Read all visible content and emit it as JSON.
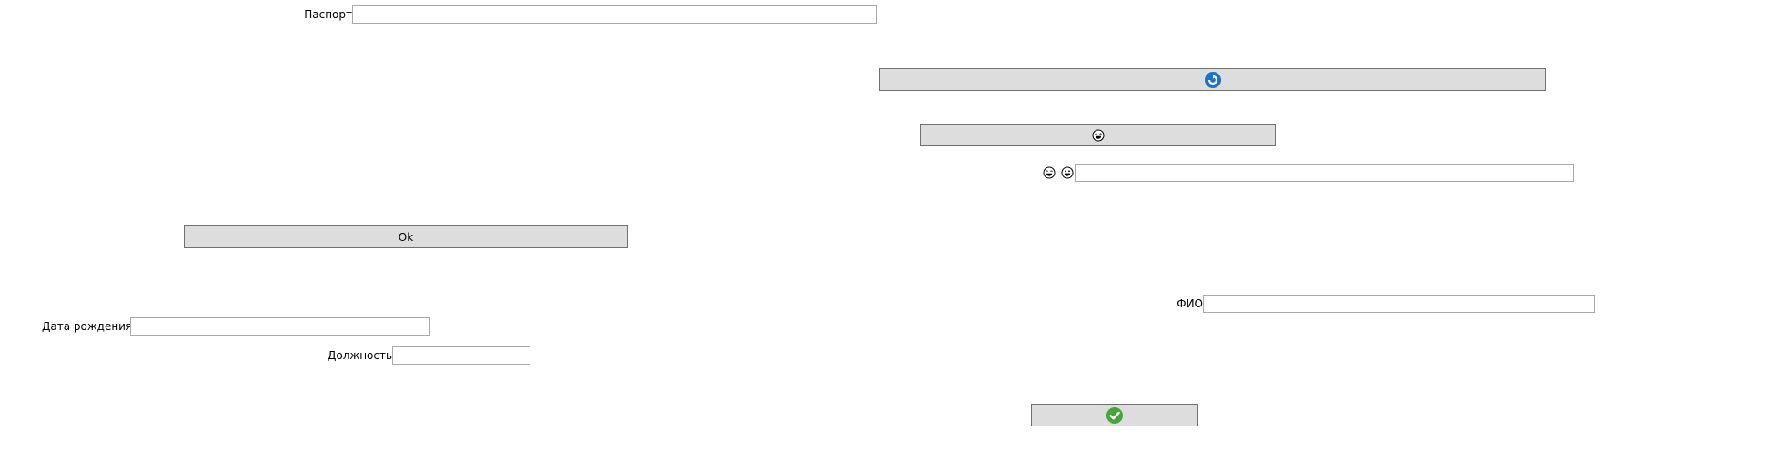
{
  "form": {
    "passport_label": "Паспорт",
    "passport_value": "",
    "birthdate_label": "Дата рождения",
    "birthdate_value": "",
    "position_label": "Должность",
    "position_value": "",
    "fio_label": "ФИО",
    "fio_value": "",
    "emoji_field_value": ""
  },
  "buttons": {
    "ok_label": "Ok"
  },
  "icons": {
    "refresh": "refresh-icon",
    "laughing_face": "laughing-face-icon",
    "smile_face": "grinning-face-icon",
    "confirm": "checkmark-icon"
  },
  "colors": {
    "refresh_blue": "#1a73c9",
    "confirm_green": "#43a53a",
    "button_bg": "#dddddd",
    "field_border": "#a9a9a9"
  }
}
